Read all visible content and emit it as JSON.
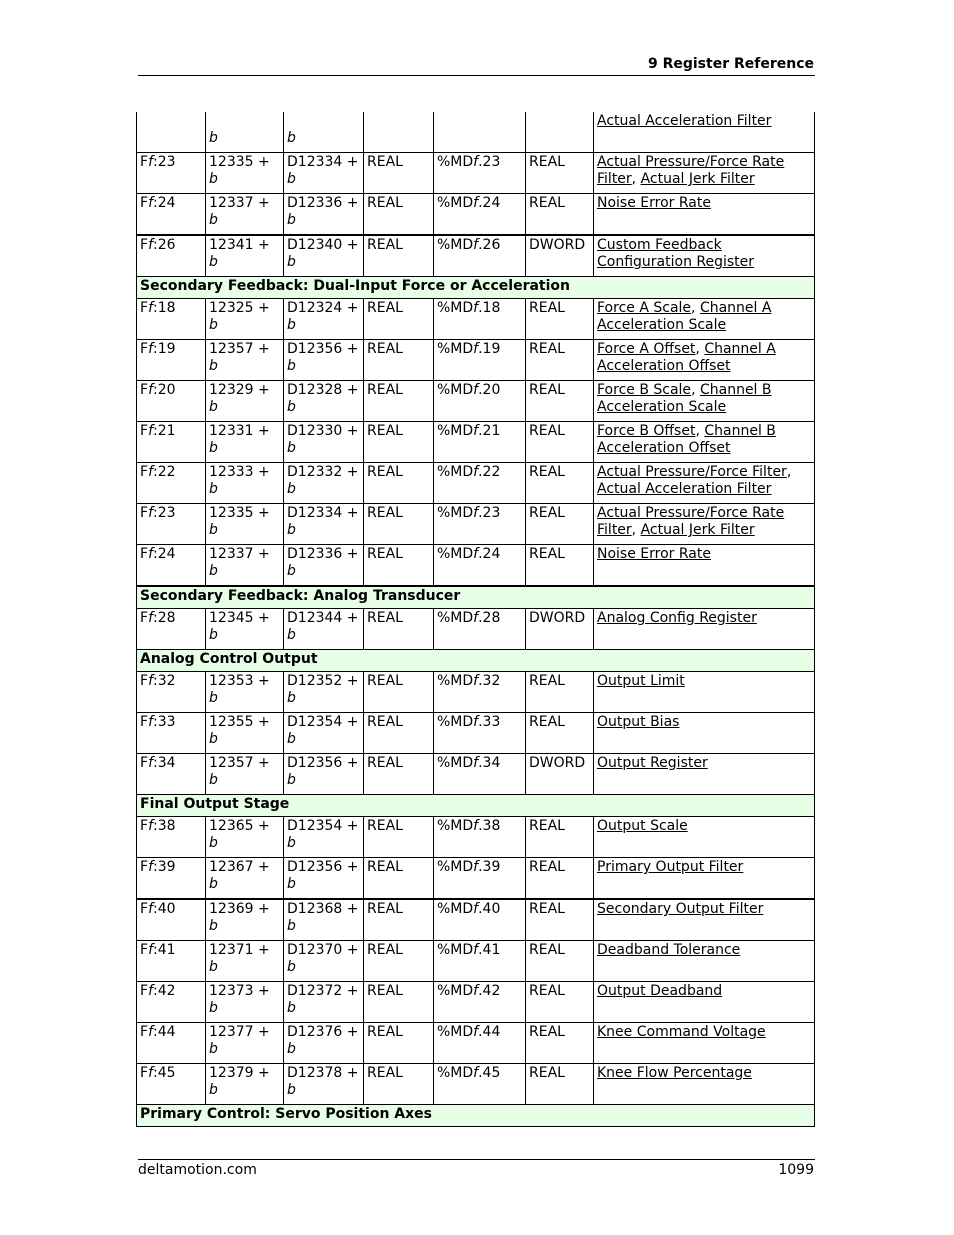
{
  "header": {
    "title": "9  Register Reference"
  },
  "footer": {
    "site": "deltamotion.com",
    "page": "1099"
  },
  "colors": {
    "section_bg": "#e6ffe6"
  },
  "rows": [
    {
      "type": "row",
      "first": true,
      "c1": "",
      "c2a": "",
      "c2b": "b",
      "c3a": "",
      "c3b": "b",
      "c4": "",
      "c5": "",
      "c6": "",
      "links": [
        "Actual Acceleration Filter"
      ]
    },
    {
      "type": "row",
      "c1": "Ff:23",
      "c2a": "12335 +",
      "c2b": "b",
      "c3a": "D12334 +",
      "c3b": "b",
      "c4": "REAL",
      "c5": "%MDf.23",
      "c6": "REAL",
      "links": [
        "Actual Pressure/Force Rate Filter",
        "Actual Jerk Filter"
      ]
    },
    {
      "type": "row",
      "c1": "Ff:24",
      "c2a": "12337 +",
      "c2b": "b",
      "c3a": "D12336 +",
      "c3b": "b",
      "c4": "REAL",
      "c5": "%MDf.24",
      "c6": "REAL",
      "links": [
        "Noise Error Rate"
      ]
    },
    {
      "type": "row",
      "thick": true,
      "c1": "Ff:26",
      "c2a": "12341 +",
      "c2b": "b",
      "c3a": "D12340 +",
      "c3b": "b",
      "c4": "REAL",
      "c5": "%MDf.26",
      "c6": "DWORD",
      "links": [
        "Custom Feedback Configuration Register"
      ]
    },
    {
      "type": "section",
      "label": "Secondary Feedback: Dual-Input Force or Acceleration"
    },
    {
      "type": "row",
      "c1": "Ff:18",
      "c2a": "12325 +",
      "c2b": "b",
      "c3a": "D12324 +",
      "c3b": "b",
      "c4": "REAL",
      "c5": "%MDf.18",
      "c6": "REAL",
      "links": [
        "Force A Scale",
        "Channel A Acceleration Scale"
      ]
    },
    {
      "type": "row",
      "c1": "Ff:19",
      "c2a": "12357 +",
      "c2b": "b",
      "c3a": "D12356 +",
      "c3b": "b",
      "c4": "REAL",
      "c5": "%MDf.19",
      "c6": "REAL",
      "links": [
        "Force A Offset",
        "Channel A Acceleration Offset"
      ]
    },
    {
      "type": "row",
      "c1": "Ff:20",
      "c2a": "12329 +",
      "c2b": "b",
      "c3a": "D12328 +",
      "c3b": "b",
      "c4": "REAL",
      "c5": "%MDf.20",
      "c6": "REAL",
      "links": [
        "Force B Scale",
        "Channel B Acceleration Scale"
      ]
    },
    {
      "type": "row",
      "c1": "Ff:21",
      "c2a": "12331 +",
      "c2b": "b",
      "c3a": "D12330 +",
      "c3b": "b",
      "c4": "REAL",
      "c5": "%MDf.21",
      "c6": "REAL",
      "links": [
        "Force B Offset",
        "Channel B Acceleration Offset"
      ]
    },
    {
      "type": "row",
      "c1": "Ff:22",
      "c2a": "12333 +",
      "c2b": "b",
      "c3a": "D12332 +",
      "c3b": "b",
      "c4": "REAL",
      "c5": "%MDf.22",
      "c6": "REAL",
      "links": [
        "Actual Pressure/Force Filter",
        "Actual Acceleration Filter"
      ]
    },
    {
      "type": "row",
      "c1": "Ff:23",
      "c2a": "12335 +",
      "c2b": "b",
      "c3a": "D12334 +",
      "c3b": "b",
      "c4": "REAL",
      "c5": "%MDf.23",
      "c6": "REAL",
      "links": [
        "Actual Pressure/Force Rate Filter",
        "Actual Jerk Filter"
      ]
    },
    {
      "type": "row",
      "c1": "Ff:24",
      "c2a": "12337 +",
      "c2b": "b",
      "c3a": "D12336 +",
      "c3b": "b",
      "c4": "REAL",
      "c5": "%MDf.24",
      "c6": "REAL",
      "links": [
        "Noise Error Rate"
      ]
    },
    {
      "type": "section",
      "thick": true,
      "label": "Secondary Feedback: Analog Transducer"
    },
    {
      "type": "row",
      "c1": "Ff:28",
      "c2a": "12345 +",
      "c2b": "b",
      "c3a": "D12344 +",
      "c3b": "b",
      "c4": "REAL",
      "c5": "%MDf.28",
      "c6": "DWORD",
      "links": [
        "Analog Config Register"
      ]
    },
    {
      "type": "section",
      "label": "Analog Control Output"
    },
    {
      "type": "row",
      "c1": "Ff:32",
      "c2a": "12353 +",
      "c2b": "b",
      "c3a": "D12352 +",
      "c3b": "b",
      "c4": "REAL",
      "c5": "%MDf.32",
      "c6": "REAL",
      "links": [
        "Output Limit"
      ]
    },
    {
      "type": "row",
      "c1": "Ff:33",
      "c2a": "12355 +",
      "c2b": "b",
      "c3a": "D12354 +",
      "c3b": "b",
      "c4": "REAL",
      "c5": "%MDf.33",
      "c6": "REAL",
      "links": [
        "Output Bias"
      ]
    },
    {
      "type": "row",
      "c1": "Ff:34",
      "c2a": "12357 +",
      "c2b": "b",
      "c3a": "D12356 +",
      "c3b": "b",
      "c4": "REAL",
      "c5": "%MDf.34",
      "c6": "DWORD",
      "links": [
        "Output Register"
      ]
    },
    {
      "type": "section",
      "label": "Final Output Stage"
    },
    {
      "type": "row",
      "c1": "Ff:38",
      "c2a": "12365 +",
      "c2b": "b",
      "c3a": "D12354 +",
      "c3b": "b",
      "c4": "REAL",
      "c5": "%MDf.38",
      "c6": "REAL",
      "links": [
        "Output Scale"
      ]
    },
    {
      "type": "row",
      "c1": "Ff:39",
      "c2a": "12367 +",
      "c2b": "b",
      "c3a": "D12356 +",
      "c3b": "b",
      "c4": "REAL",
      "c5": "%MDf.39",
      "c6": "REAL",
      "links": [
        "Primary Output Filter"
      ]
    },
    {
      "type": "row",
      "thick": true,
      "c1": "Ff:40",
      "c2a": "12369 +",
      "c2b": "b",
      "c3a": "D12368 +",
      "c3b": "b",
      "c4": "REAL",
      "c5": "%MDf.40",
      "c6": "REAL",
      "links": [
        "Secondary Output Filter"
      ]
    },
    {
      "type": "row",
      "c1": "Ff:41",
      "c2a": "12371 +",
      "c2b": "b",
      "c3a": "D12370 +",
      "c3b": "b",
      "c4": "REAL",
      "c5": "%MDf.41",
      "c6": "REAL",
      "links": [
        "Deadband Tolerance"
      ]
    },
    {
      "type": "row",
      "c1": "Ff:42",
      "c2a": "12373 +",
      "c2b": "b",
      "c3a": "D12372 +",
      "c3b": "b",
      "c4": "REAL",
      "c5": "%MDf.42",
      "c6": "REAL",
      "links": [
        "Output Deadband"
      ]
    },
    {
      "type": "row",
      "c1": "Ff:44",
      "c2a": "12377 +",
      "c2b": "b",
      "c3a": "D12376 +",
      "c3b": "b",
      "c4": "REAL",
      "c5": "%MDf.44",
      "c6": "REAL",
      "links": [
        "Knee Command Voltage"
      ]
    },
    {
      "type": "row",
      "c1": "Ff:45",
      "c2a": "12379 +",
      "c2b": "b",
      "c3a": "D12378 +",
      "c3b": "b",
      "c4": "REAL",
      "c5": "%MDf.45",
      "c6": "REAL",
      "links": [
        "Knee Flow Percentage"
      ]
    },
    {
      "type": "section",
      "label": "Primary Control: Servo Position Axes"
    }
  ]
}
